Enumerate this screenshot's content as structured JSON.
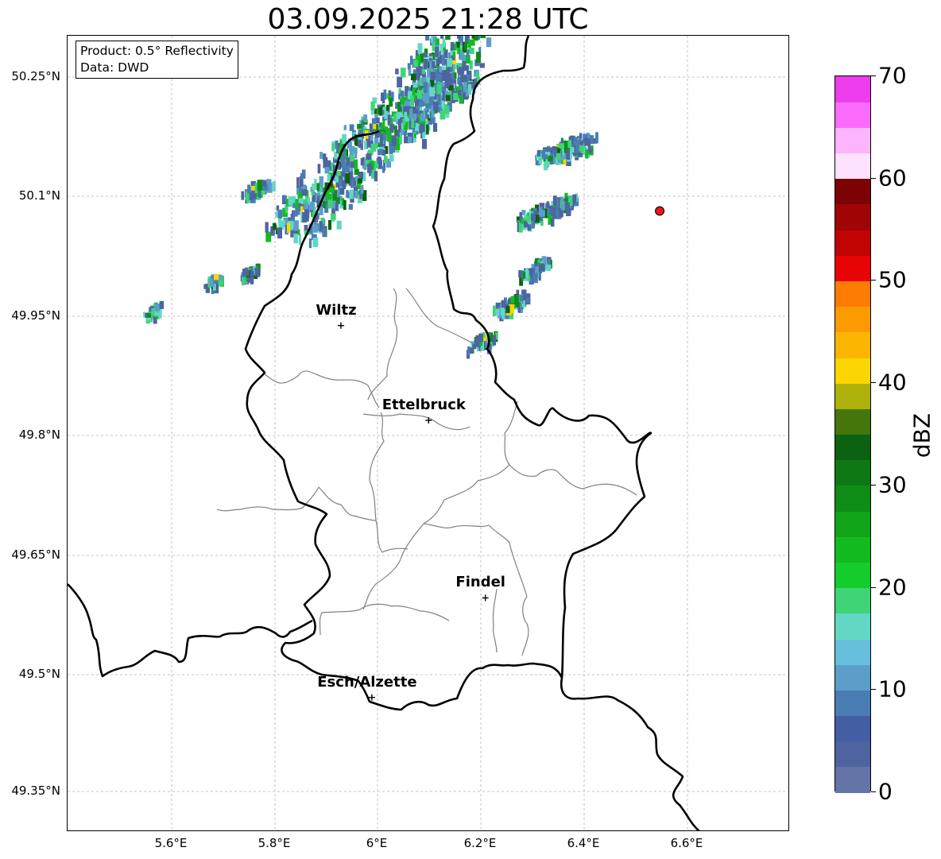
{
  "title": "03.09.2025 21:28 UTC",
  "info": {
    "product": "Product: 0.5° Reflectivity",
    "data": "Data: DWD"
  },
  "lat_ticks": [
    "50.25°N",
    "50.1°N",
    "49.95°N",
    "49.8°N",
    "49.65°N",
    "49.5°N",
    "49.35°N"
  ],
  "lon_ticks": [
    "5.6°E",
    "5.8°E",
    "6°E",
    "6.2°E",
    "6.4°E",
    "6.6°E"
  ],
  "cities": [
    {
      "name": "Wiltz",
      "lon": 5.93,
      "lat": 49.966
    },
    {
      "name": "Ettelbruck",
      "lon": 6.1,
      "lat": 49.847
    },
    {
      "name": "Findel",
      "lon": 6.21,
      "lat": 49.624
    },
    {
      "name": "Esch/Alzette",
      "lon": 5.99,
      "lat": 49.499
    }
  ],
  "radar_site": {
    "lon": 6.548,
    "lat": 50.11,
    "color": "#e8141b"
  },
  "colorbar": {
    "label": "dBZ",
    "min": 0,
    "max": 70,
    "step": 2.5,
    "tick_labels": [
      "0",
      "10",
      "20",
      "30",
      "40",
      "50",
      "60",
      "70"
    ],
    "colors": [
      "#6474a6",
      "#4e64a0",
      "#445ea4",
      "#4a7cb4",
      "#5c9ec9",
      "#66c0dd",
      "#62d8c4",
      "#3fd476",
      "#14cc2a",
      "#12bc1e",
      "#10a418",
      "#0e8c16",
      "#0e7814",
      "#0b6210",
      "#44760c",
      "#aeb20a",
      "#fcd602",
      "#fcb602",
      "#fc9a02",
      "#fc7c02",
      "#e80404",
      "#c00404",
      "#a00404",
      "#7c0204",
      "#fce2fc",
      "#fcb4fc",
      "#fc6cfc",
      "#ec3cec"
    ]
  }
}
